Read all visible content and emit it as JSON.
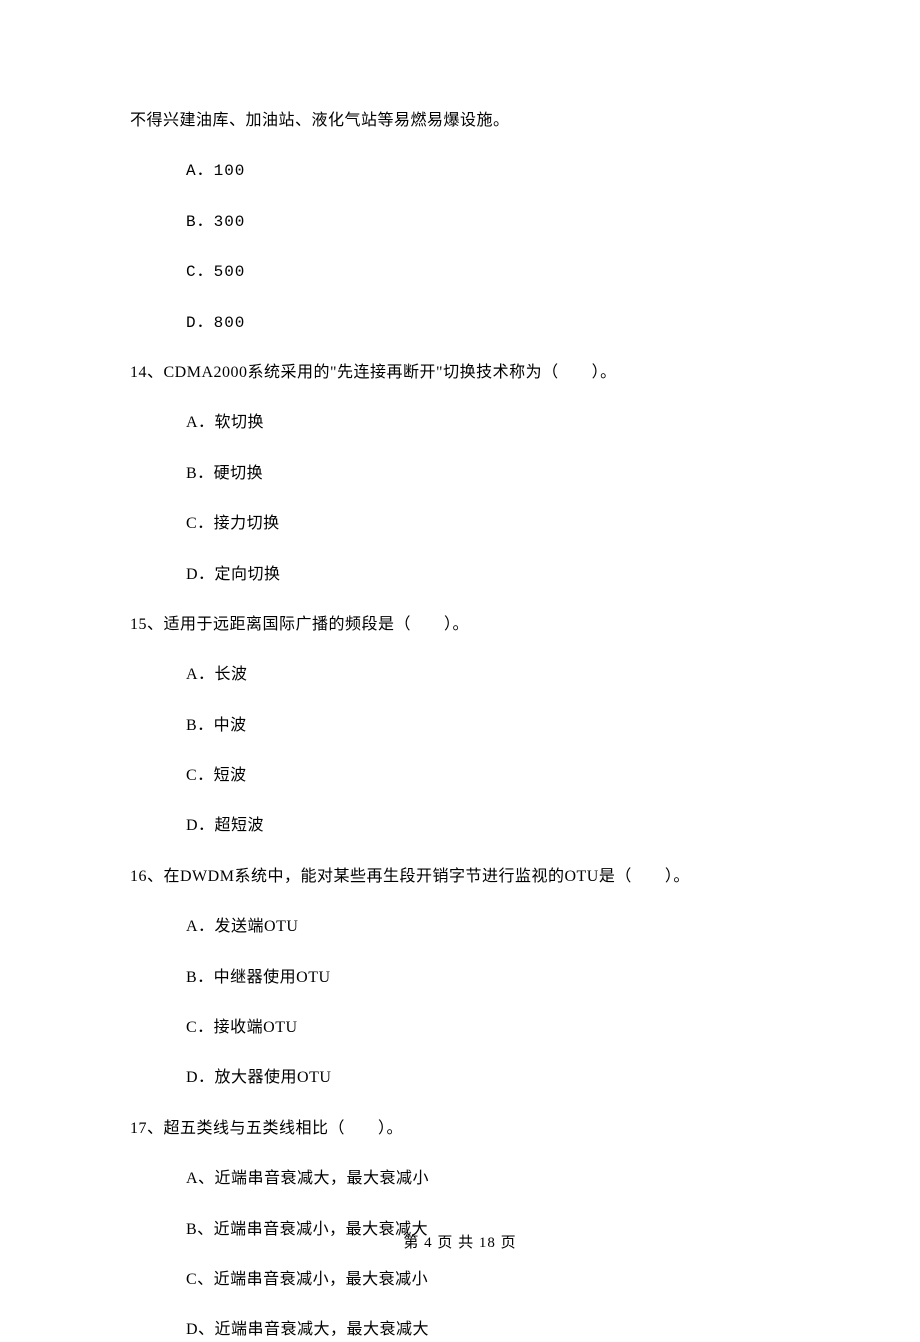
{
  "continuation": "不得兴建油库、加油站、液化气站等易燃易爆设施。",
  "q13": {
    "optA": "A．100",
    "optB": "B．300",
    "optC": "C．500",
    "optD": "D．800"
  },
  "q14": {
    "text": "14、CDMA2000系统采用的\"先连接再断开\"切换技术称为（　　）。",
    "optA": "A．软切换",
    "optB": "B．硬切换",
    "optC": "C．接力切换",
    "optD": "D．定向切换"
  },
  "q15": {
    "text": "15、适用于远距离国际广播的频段是（　　）。",
    "optA": "A．长波",
    "optB": "B．中波",
    "optC": "C．短波",
    "optD": "D．超短波"
  },
  "q16": {
    "text": "16、在DWDM系统中，能对某些再生段开销字节进行监视的OTU是（　　）。",
    "optA": "A．发送端OTU",
    "optB": "B．中继器使用OTU",
    "optC": "C．接收端OTU",
    "optD": "D．放大器使用OTU"
  },
  "q17": {
    "text": "17、超五类线与五类线相比（　　）。",
    "optA": "A、近端串音衰减大，最大衰减小",
    "optB": "B、近端串音衰减小，最大衰减大",
    "optC": "C、近端串音衰减小，最大衰减小",
    "optD": "D、近端串音衰减大，最大衰减大"
  },
  "footer": "第 4 页 共 18 页"
}
